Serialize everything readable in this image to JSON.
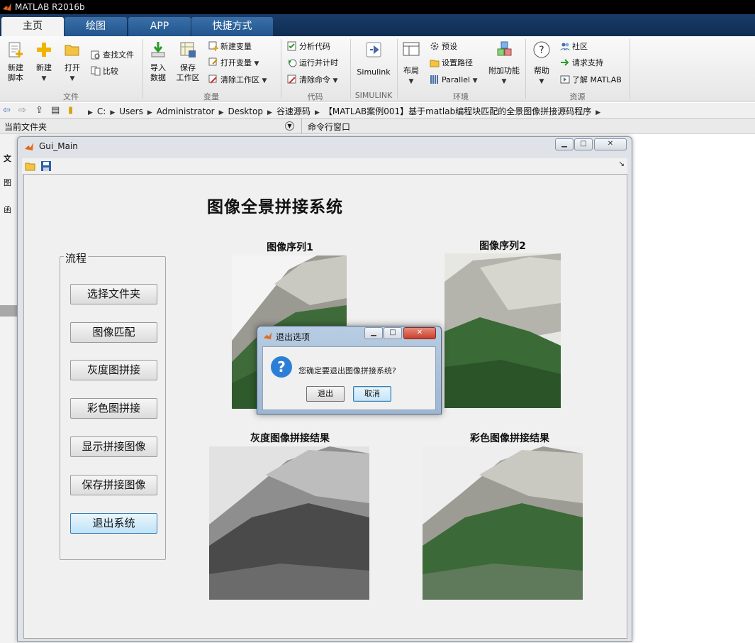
{
  "app": {
    "title": "MATLAB R2016b"
  },
  "ribbon_tabs": [
    {
      "label": "主页",
      "active": true
    },
    {
      "label": "绘图",
      "active": false
    },
    {
      "label": "APP",
      "active": false
    },
    {
      "label": "快捷方式",
      "active": false
    }
  ],
  "ribbon": {
    "file": {
      "group_label": "文件",
      "new_script": "新建\n脚本",
      "new": "新建",
      "open": "打开",
      "find_files": "查找文件",
      "compare": "比较"
    },
    "variable": {
      "group_label": "变量",
      "import_data": "导入\n数据",
      "save_workspace": "保存\n工作区",
      "new_variable": "新建变量",
      "open_variable": "打开变量",
      "clear_workspace": "清除工作区"
    },
    "code": {
      "group_label": "代码",
      "analyze_code": "分析代码",
      "run_and_time": "运行并计时",
      "clear_commands": "清除命令"
    },
    "simulink": {
      "group_label": "SIMULINK",
      "simulink": "Simulink"
    },
    "environment": {
      "group_label": "环境",
      "layout": "布局",
      "preferences": "预设",
      "set_path": "设置路径",
      "parallel": "Parallel",
      "addons": "附加功能"
    },
    "resources": {
      "group_label": "资源",
      "help": "帮助",
      "community": "社区",
      "request_support": "请求支持",
      "learn_matlab": "了解 MATLAB"
    }
  },
  "address": {
    "crumbs": [
      "C:",
      "Users",
      "Administrator",
      "Desktop",
      "谷速源码",
      "【MATLAB案例001】基于matlab编程块匹配的全景图像拼接源码程序"
    ]
  },
  "panels": {
    "current_folder": "当前文件夹",
    "command_window": "命令行窗口"
  },
  "left_panel_items": [
    "文",
    "图",
    "函"
  ],
  "figure": {
    "title": "Gui_Main",
    "app_title": "图像全景拼接系统",
    "process_label": "流程",
    "buttons": [
      "选择文件夹",
      "图像匹配",
      "灰度图拼接",
      "彩色图拼接",
      "显示拼接图像",
      "保存拼接图像",
      "退出系统"
    ],
    "captions": {
      "seq1": "图像序列1",
      "seq2": "图像序列2",
      "gray_result": "灰度图像拼接结果",
      "color_result": "彩色图像拼接结果"
    }
  },
  "dialog": {
    "title": "退出选项",
    "message": "您确定要退出图像拼接系统?",
    "exit_button": "退出",
    "cancel_button": "取消"
  }
}
